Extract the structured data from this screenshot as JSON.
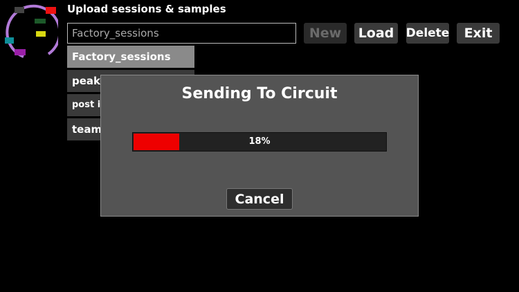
{
  "header": {
    "title": "Upload sessions & samples",
    "logo_icon": "circuit-logo-icon"
  },
  "name_field": {
    "value": "Factory_sessions"
  },
  "toolbar": {
    "new_label": "New",
    "load_label": "Load",
    "delete_label": "Delete",
    "exit_label": "Exit"
  },
  "session_list": {
    "items": [
      {
        "label": "Factory_sessions",
        "selected": true
      },
      {
        "label": "peak ("
      },
      {
        "label": "post inc"
      },
      {
        "label": "team r"
      }
    ]
  },
  "dialog": {
    "title": "Sending To Circuit",
    "progress_text": "18%",
    "progress_fraction": 0.18,
    "progress_color": "#ee0000",
    "cancel_label": "Cancel"
  },
  "colors": {
    "background": "#000000",
    "dialog_bg": "#545454",
    "selected_item": "#8a8a8a",
    "button_bg": "#3a3a3a"
  }
}
